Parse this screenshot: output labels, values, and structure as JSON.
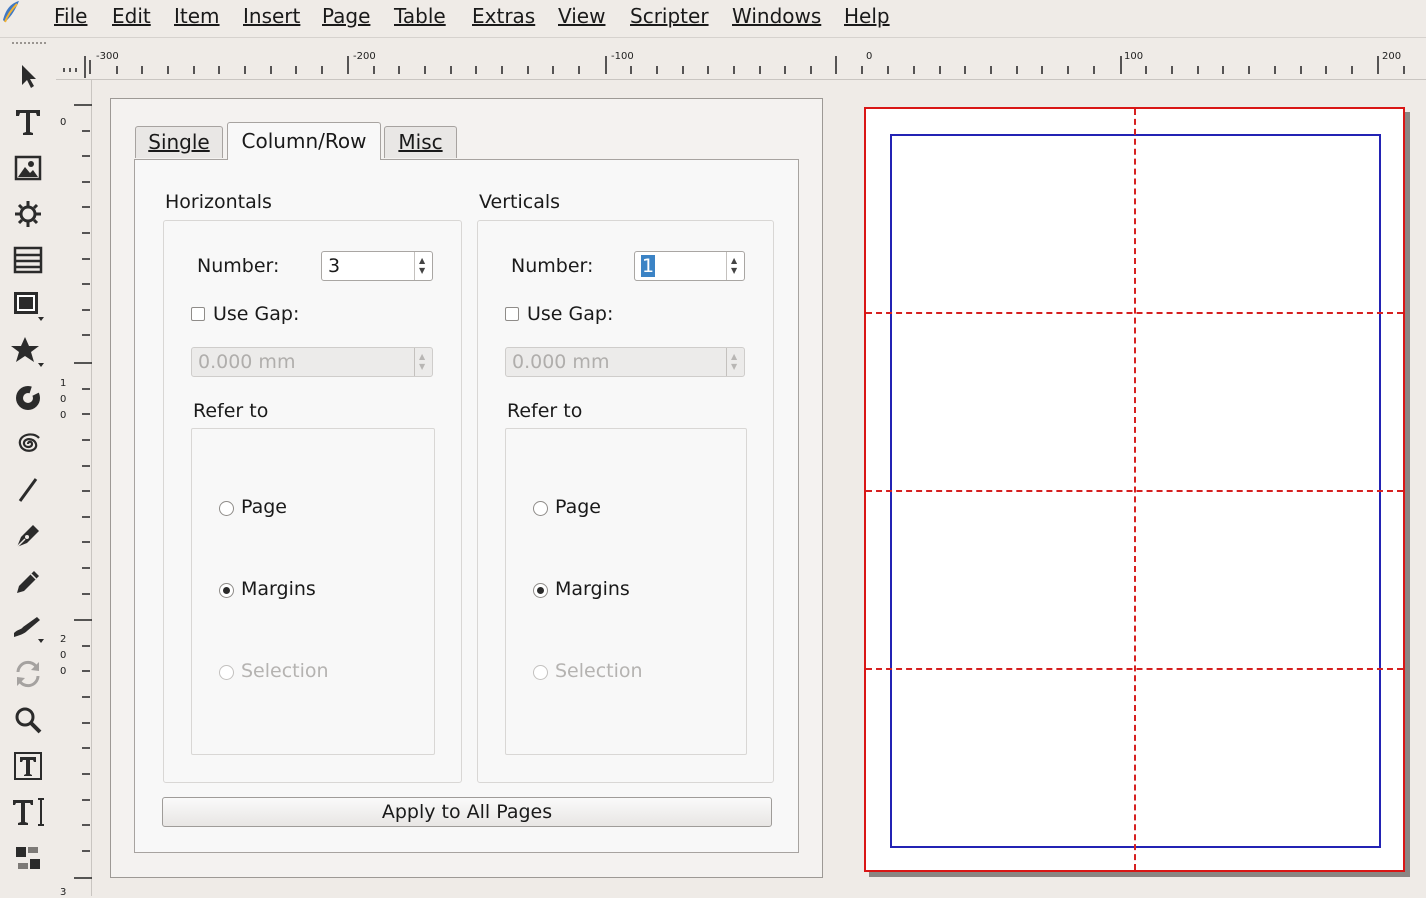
{
  "menubar": {
    "items": [
      {
        "label": "File",
        "mnemonic_index": 0
      },
      {
        "label": "Edit",
        "mnemonic_index": 0
      },
      {
        "label": "Item",
        "mnemonic_index": 0
      },
      {
        "label": "Insert",
        "mnemonic_index": 0
      },
      {
        "label": "Page",
        "mnemonic_index": 0
      },
      {
        "label": "Table",
        "mnemonic_index": 0
      },
      {
        "label": "Extras",
        "mnemonic_index": 1
      },
      {
        "label": "View",
        "mnemonic_index": 0
      },
      {
        "label": "Scripter",
        "mnemonic_index": 0
      },
      {
        "label": "Windows",
        "mnemonic_index": 0
      },
      {
        "label": "Help",
        "mnemonic_index": 0
      }
    ]
  },
  "toolbox": {
    "tools": [
      "select-icon",
      "text-frame-icon",
      "image-frame-icon",
      "render-frame-icon",
      "table-icon",
      "shape-icon",
      "polygon-icon",
      "arc-icon",
      "spiral-icon",
      "line-icon",
      "bezier-icon",
      "freehand-icon",
      "calligraphic-icon",
      "rotate-icon",
      "zoom-icon",
      "edit-text-icon",
      "link-text-frames-icon",
      "unlink-text-frames-icon"
    ]
  },
  "rulers": {
    "horizontal_labels": [
      "-300",
      "-200",
      "-100",
      "0",
      "100",
      "200"
    ],
    "vertical_labels": [
      "0",
      "100",
      "200",
      "3"
    ]
  },
  "dialog": {
    "tabs": [
      {
        "label": "Single",
        "mnemonic_index": 0,
        "active": false
      },
      {
        "label": "Column/Row",
        "mnemonic_index": 0,
        "active": true
      },
      {
        "label": "Misc",
        "mnemonic_index": 0,
        "active": false
      }
    ],
    "horizontals": {
      "title": "Horizontals",
      "number_label": "Number:",
      "number_value": "3",
      "use_gap_label": "Use Gap:",
      "use_gap_checked": false,
      "gap_value": "0.000 mm",
      "refer_to_label": "Refer to",
      "options": {
        "page": "Page",
        "margins": "Margins",
        "selection": "Selection"
      },
      "selected": "margins"
    },
    "verticals": {
      "title": "Verticals",
      "number_label": "Number:",
      "number_value": "1",
      "use_gap_label": "Use Gap:",
      "use_gap_checked": false,
      "gap_value": "0.000 mm",
      "refer_to_label": "Refer to",
      "options": {
        "page": "Page",
        "margins": "Margins",
        "selection": "Selection"
      },
      "selected": "margins"
    },
    "apply_button": "Apply to All Pages"
  },
  "preview": {
    "page_border_color": "#d91616",
    "margin_color": "#2323b4",
    "guide_color": "#d62020",
    "horizontal_guides": 3,
    "vertical_guides": 1
  }
}
